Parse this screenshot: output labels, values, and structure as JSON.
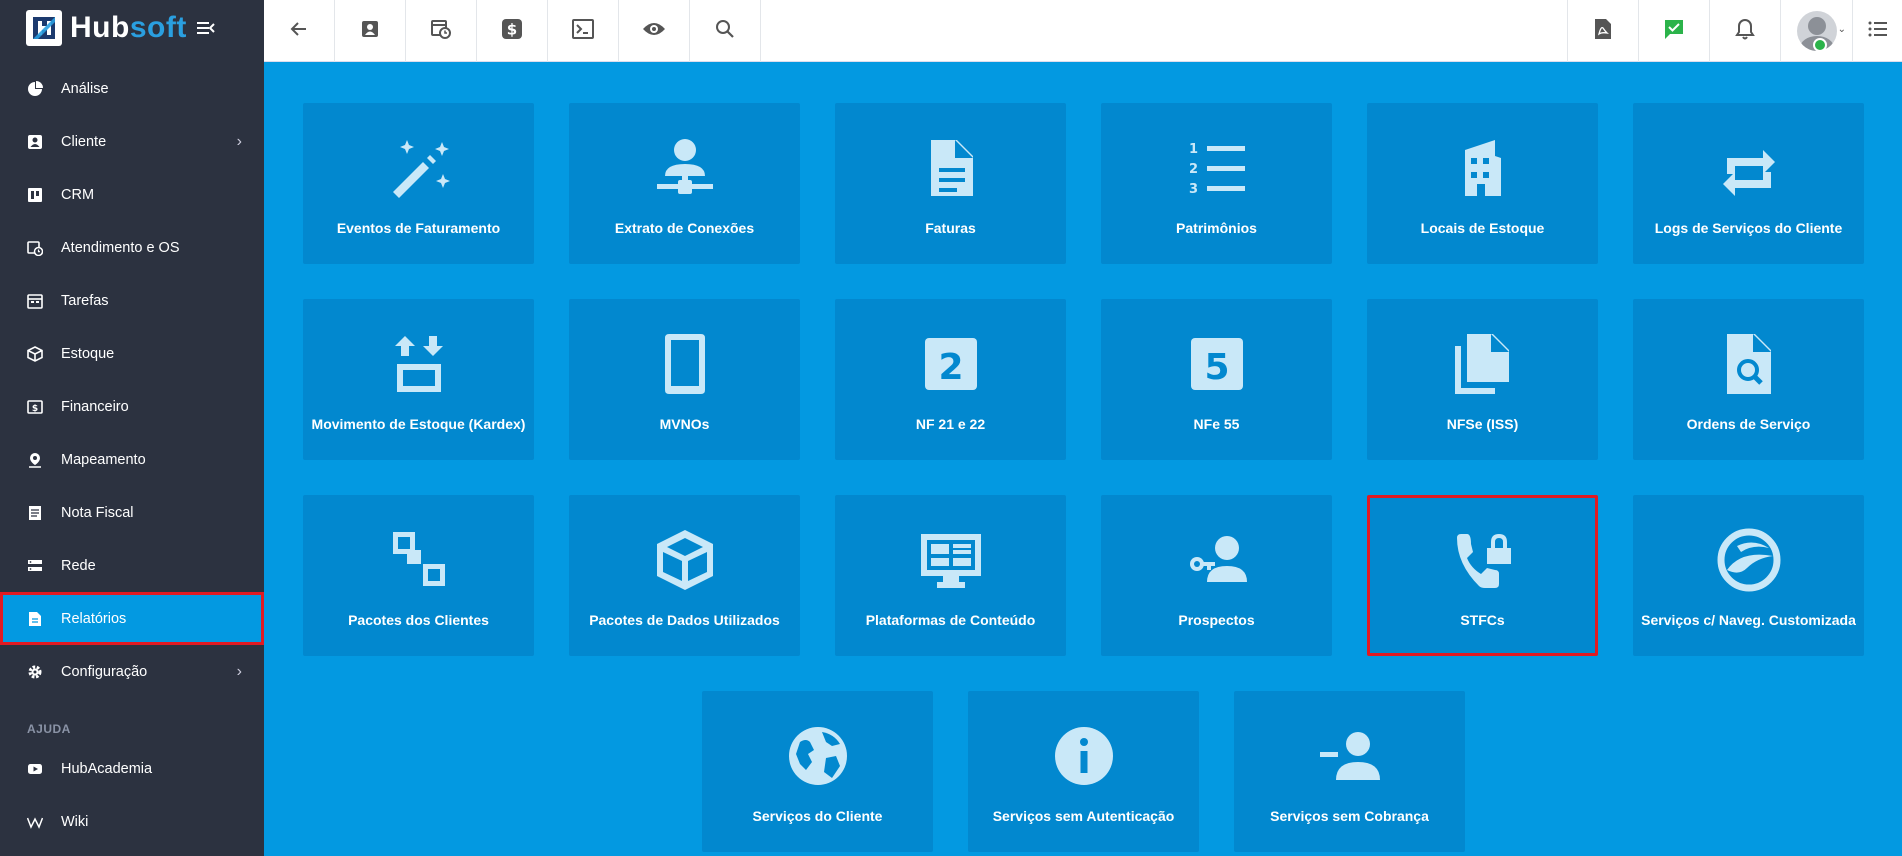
{
  "app": {
    "brand_hub": "Hub",
    "brand_soft": "soft"
  },
  "sidebar": {
    "items": [
      {
        "label": "Análise",
        "icon": "chart-pie-icon"
      },
      {
        "label": "Cliente",
        "icon": "contact-card-icon",
        "has_submenu": true
      },
      {
        "label": "CRM",
        "icon": "kanban-icon"
      },
      {
        "label": "Atendimento e OS",
        "icon": "calendar-clock-icon"
      },
      {
        "label": "Tarefas",
        "icon": "calendar-tasks-icon"
      },
      {
        "label": "Estoque",
        "icon": "package-icon"
      },
      {
        "label": "Financeiro",
        "icon": "money-icon"
      },
      {
        "label": "Mapeamento",
        "icon": "map-pin-icon"
      },
      {
        "label": "Nota Fiscal",
        "icon": "receipt-icon"
      },
      {
        "label": "Rede",
        "icon": "network-icon"
      },
      {
        "label": "Relatórios",
        "icon": "report-icon",
        "active": true
      },
      {
        "label": "Configuração",
        "icon": "gear-icon",
        "has_submenu": true
      }
    ],
    "help_section": "AJUDA",
    "help_items": [
      {
        "label": "HubAcademia",
        "icon": "youtube-icon"
      },
      {
        "label": "Wiki",
        "icon": "wikipedia-icon"
      }
    ]
  },
  "topbar": {
    "left_buttons": [
      "back-arrow-icon",
      "contact-card-icon",
      "calendar-clock-icon",
      "dollar-icon",
      "terminal-icon",
      "eye-icon",
      "search-icon"
    ],
    "right_buttons": [
      "pdf-icon",
      "chat-check-icon",
      "bell-icon"
    ]
  },
  "tiles": [
    {
      "label": "Eventos de Faturamento",
      "icon": "magic-wand-icon"
    },
    {
      "label": "Extrato de Conexões",
      "icon": "account-network-icon"
    },
    {
      "label": "Faturas",
      "icon": "document-icon"
    },
    {
      "label": "Patrimônios",
      "icon": "numbered-list-icon"
    },
    {
      "label": "Locais de Estoque",
      "icon": "building-icon"
    },
    {
      "label": "Logs de Serviços do Cliente",
      "icon": "repeat-icon"
    },
    {
      "label": "Movimento de Estoque (Kardex)",
      "icon": "swap-vertical-icon"
    },
    {
      "label": "MVNOs",
      "icon": "cellphone-icon"
    },
    {
      "label": "NF 21 e 22",
      "icon": "numeric-2-box-icon"
    },
    {
      "label": "NFe 55",
      "icon": "numeric-5-box-icon"
    },
    {
      "label": "NFSe (ISS)",
      "icon": "file-multiple-icon"
    },
    {
      "label": "Ordens de Serviço",
      "icon": "file-search-icon"
    },
    {
      "label": "Pacotes dos Clientes",
      "icon": "group-icon"
    },
    {
      "label": "Pacotes de Dados Utilizados",
      "icon": "cube-icon"
    },
    {
      "label": "Plataformas de Conteúdo",
      "icon": "monitor-dashboard-icon"
    },
    {
      "label": "Prospectos",
      "icon": "account-key-icon"
    },
    {
      "label": "STFCs",
      "icon": "phone-lock-icon",
      "highlighted": true
    },
    {
      "label": "Serviços c/ Naveg. Customizada",
      "icon": "google-earth-icon"
    },
    {
      "label": "Serviços do Cliente",
      "icon": "earth-icon"
    },
    {
      "label": "Serviços sem Autenticação",
      "icon": "information-icon"
    },
    {
      "label": "Serviços sem Cobrança",
      "icon": "account-minus-icon"
    }
  ]
}
